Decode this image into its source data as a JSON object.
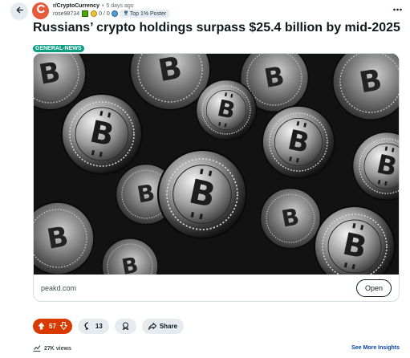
{
  "post": {
    "subreddit": "r/CryptoCurrency",
    "separator": "•",
    "time": "5 days ago",
    "username": "rose98734",
    "karma": "0 / 0",
    "badge": "Top 1% Poster",
    "title": "Russians’ crypto holdings surpass $25.4 billion by mid-2025",
    "flair": "GENERAL-NEWS"
  },
  "link_card": {
    "domain": "peakd.com",
    "open_label": "Open",
    "image_subject": "pile of silver bitcoin coins, black and white photo"
  },
  "actions": {
    "vote_count": "57",
    "comment_count": "13",
    "share_label": "Share"
  },
  "footer": {
    "views": "27K views",
    "insights_label": "See More Insights"
  },
  "colors": {
    "upvoted": "#d93a00",
    "flair_bg": "#0a9e83",
    "avatar": "#e55b3c",
    "link": "#0045ac"
  }
}
